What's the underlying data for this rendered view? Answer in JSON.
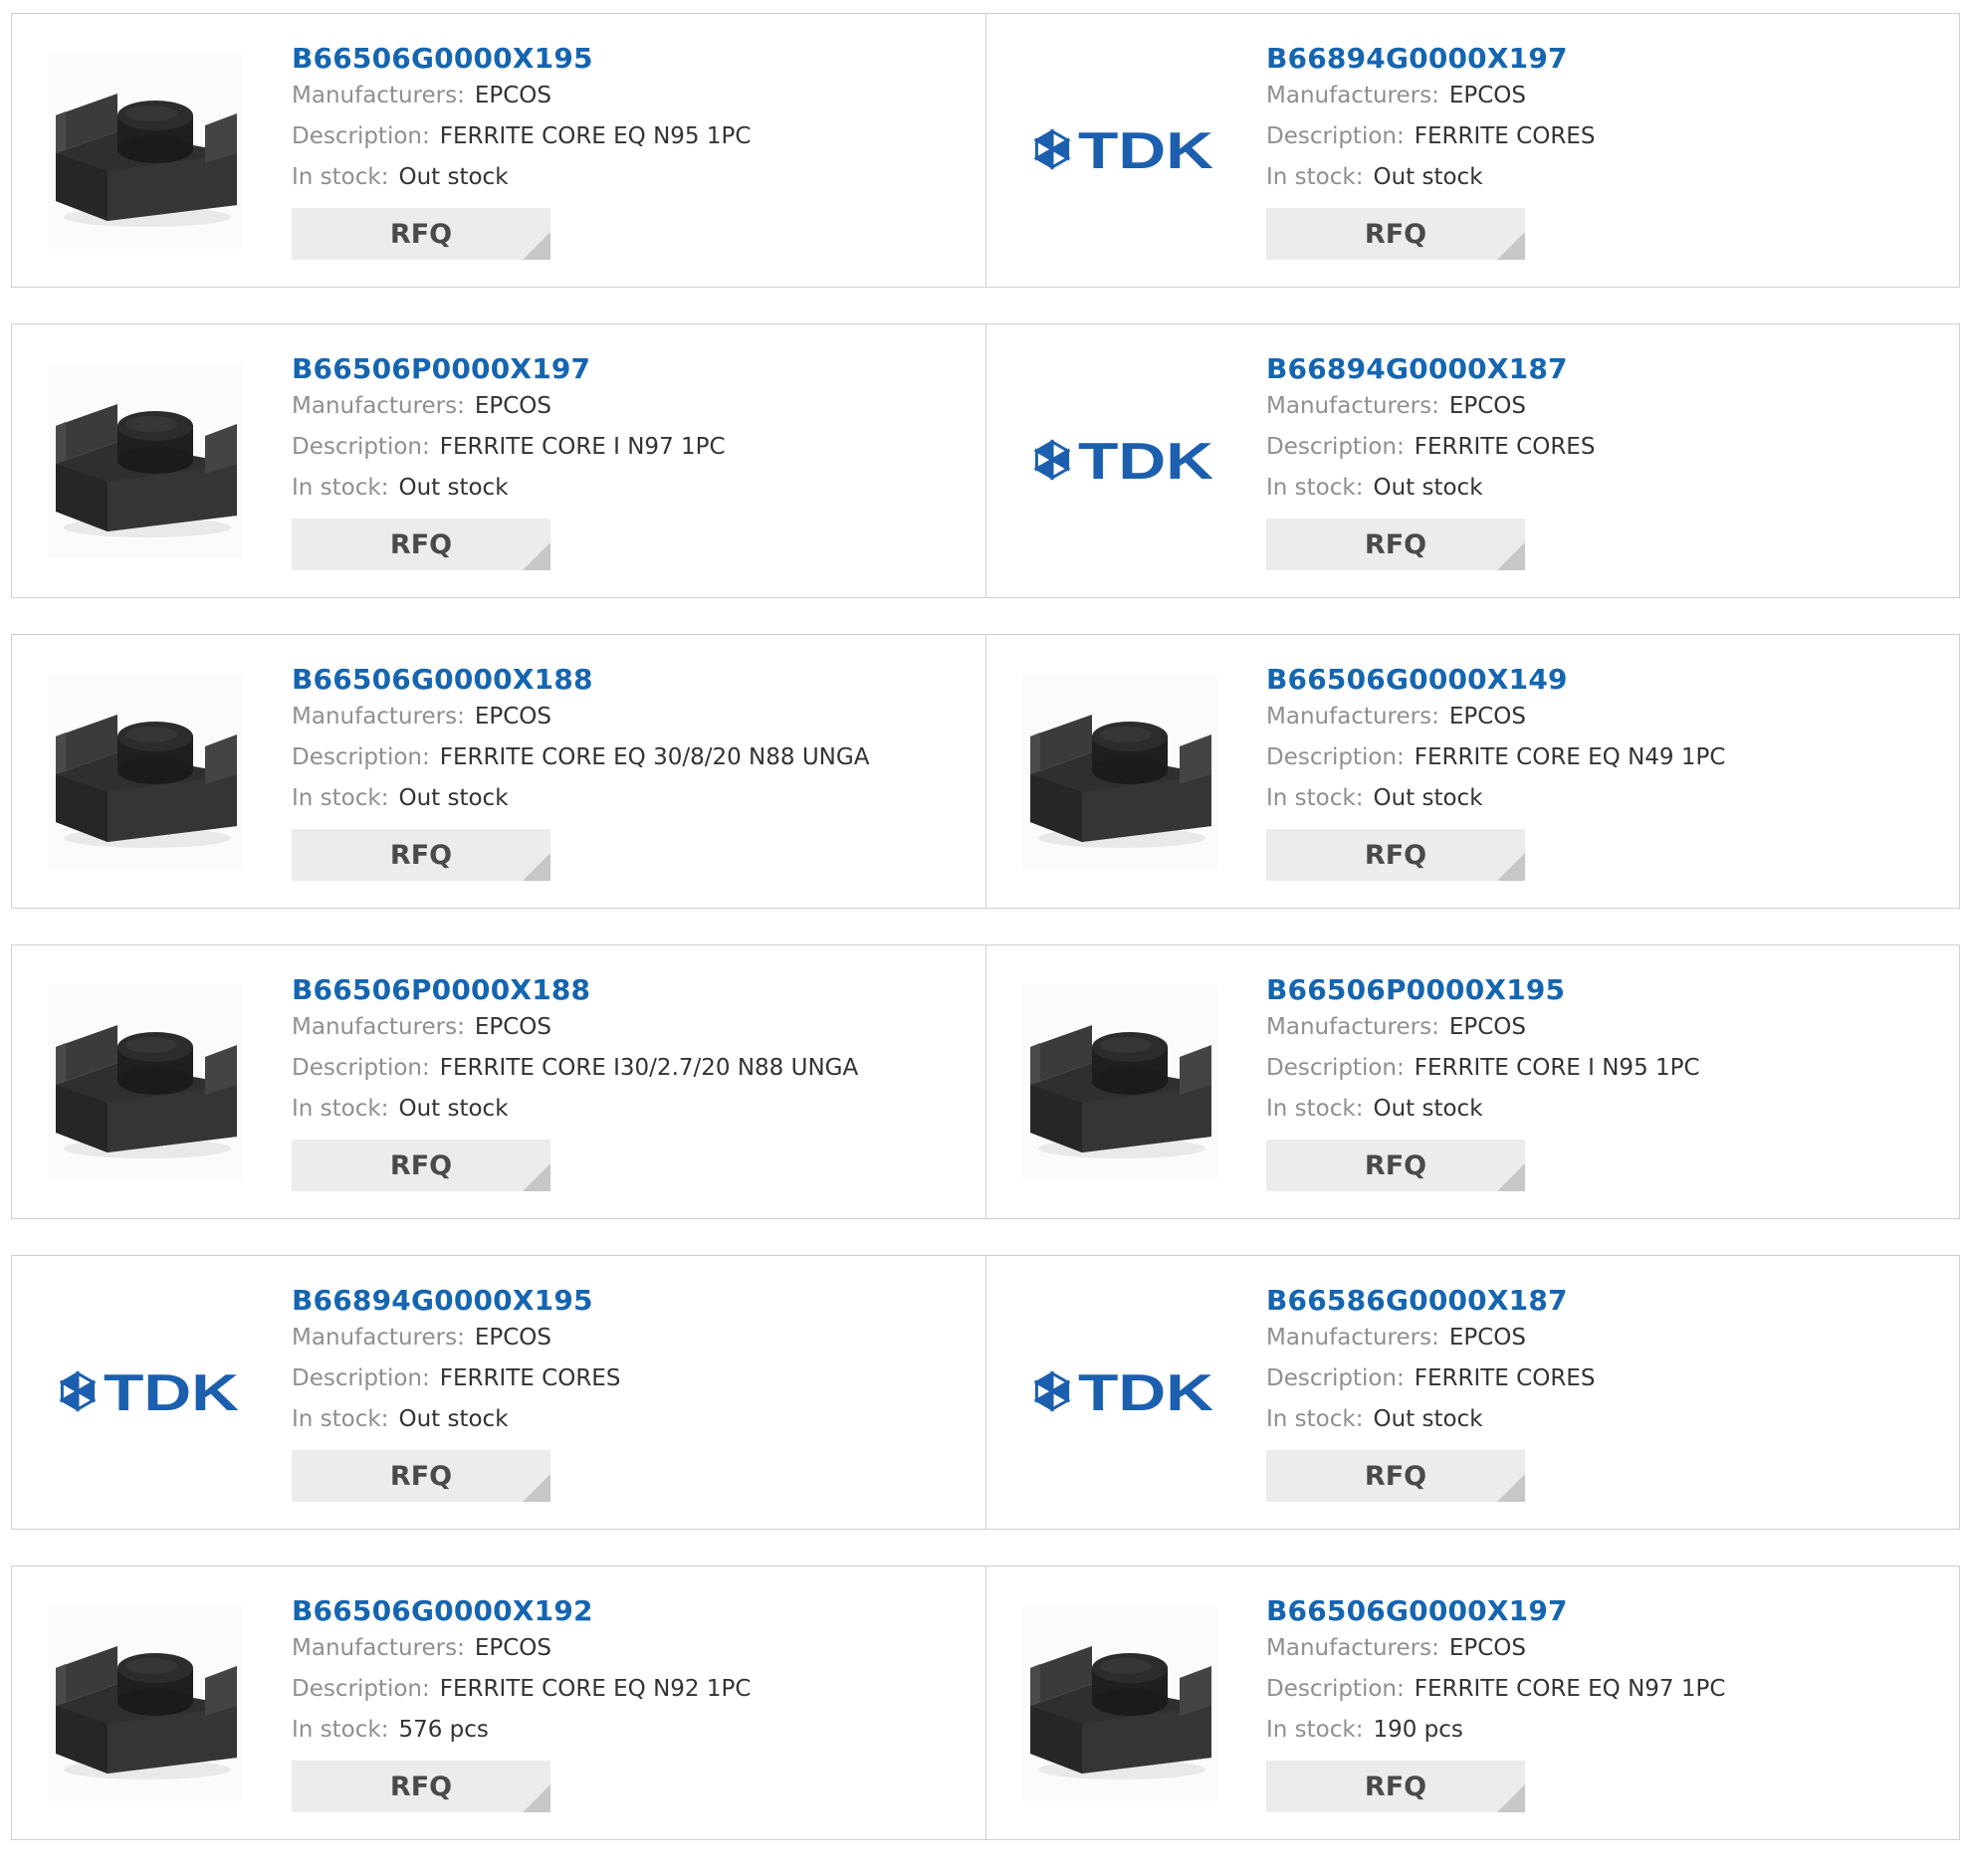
{
  "labels": {
    "manufacturers": "Manufacturers:",
    "description": "Description:",
    "in_stock": "In stock:",
    "rfq": "RFQ"
  },
  "colors": {
    "part_link": "#1565b0",
    "tdk_logo": "#1c5fae",
    "rfq_bg": "#ececec"
  },
  "products": [
    {
      "part": "B66506G0000X195",
      "manufacturer": "EPCOS",
      "description": "FERRITE CORE EQ N95 1PC",
      "stock": "Out stock",
      "image": "ferrite-core"
    },
    {
      "part": "B66894G0000X197",
      "manufacturer": "EPCOS",
      "description": "FERRITE CORES",
      "stock": "Out stock",
      "image": "tdk-logo",
      "logo_text": "TDK"
    },
    {
      "part": "B66506P0000X197",
      "manufacturer": "EPCOS",
      "description": "FERRITE CORE I N97 1PC",
      "stock": "Out stock",
      "image": "ferrite-core"
    },
    {
      "part": "B66894G0000X187",
      "manufacturer": "EPCOS",
      "description": "FERRITE CORES",
      "stock": "Out stock",
      "image": "tdk-logo",
      "logo_text": "TDK"
    },
    {
      "part": "B66506G0000X188",
      "manufacturer": "EPCOS",
      "description": "FERRITE CORE EQ 30/8/20 N88 UNGA",
      "stock": "Out stock",
      "image": "ferrite-core"
    },
    {
      "part": "B66506G0000X149",
      "manufacturer": "EPCOS",
      "description": "FERRITE CORE EQ N49 1PC",
      "stock": "Out stock",
      "image": "ferrite-core"
    },
    {
      "part": "B66506P0000X188",
      "manufacturer": "EPCOS",
      "description": "FERRITE CORE I30/2.7/20 N88 UNGA",
      "stock": "Out stock",
      "image": "ferrite-core"
    },
    {
      "part": "B66506P0000X195",
      "manufacturer": "EPCOS",
      "description": "FERRITE CORE I N95 1PC",
      "stock": "Out stock",
      "image": "ferrite-core"
    },
    {
      "part": "B66894G0000X195",
      "manufacturer": "EPCOS",
      "description": "FERRITE CORES",
      "stock": "Out stock",
      "image": "tdk-logo",
      "logo_text": "TDK"
    },
    {
      "part": "B66586G0000X187",
      "manufacturer": "EPCOS",
      "description": "FERRITE CORES",
      "stock": "Out stock",
      "image": "tdk-logo",
      "logo_text": "TDK"
    },
    {
      "part": "B66506G0000X192",
      "manufacturer": "EPCOS",
      "description": "FERRITE CORE EQ N92 1PC",
      "stock": "576 pcs",
      "image": "ferrite-core"
    },
    {
      "part": "B66506G0000X197",
      "manufacturer": "EPCOS",
      "description": "FERRITE CORE EQ N97 1PC",
      "stock": "190 pcs",
      "image": "ferrite-core"
    }
  ]
}
